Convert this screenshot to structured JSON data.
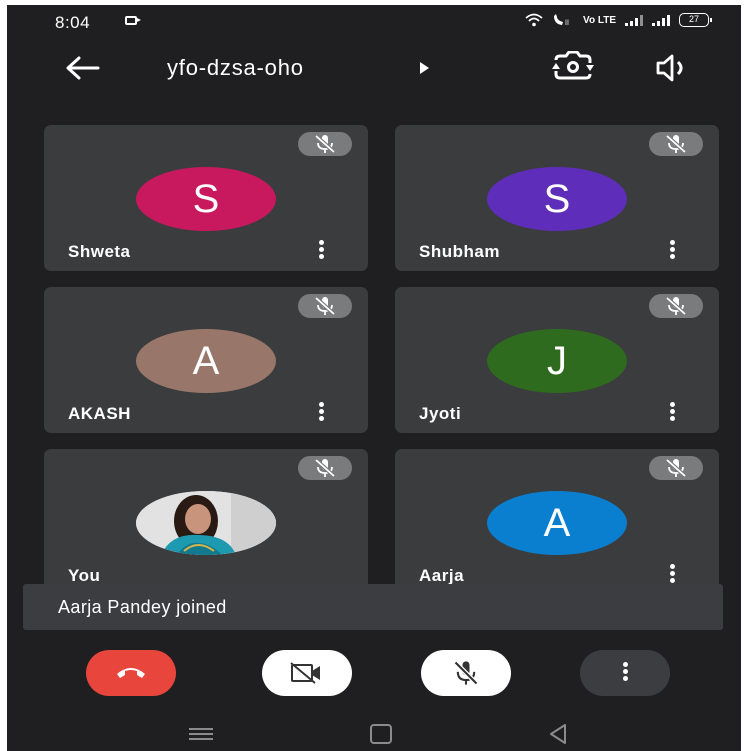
{
  "status_bar": {
    "time": "8:04",
    "network_label": "Vo LTE",
    "battery": "27"
  },
  "header": {
    "meeting_code": "yfo-dzsa-oho"
  },
  "participants": [
    {
      "name": "Shweta",
      "initial": "S",
      "color": "#c8195e",
      "muted": true
    },
    {
      "name": "Shubham",
      "initial": "S",
      "color": "#5e2dba",
      "muted": true
    },
    {
      "name": "AKASH",
      "initial": "A",
      "color": "#99766a",
      "muted": true
    },
    {
      "name": "Jyoti",
      "initial": "J",
      "color": "#2e6b1f",
      "muted": true
    },
    {
      "name": "You",
      "initial": "",
      "color": "#e4e4e4",
      "muted": true
    },
    {
      "name": "Aarja",
      "initial": "A",
      "color": "#0a7fcf",
      "muted": true
    }
  ],
  "toast": {
    "message": "Aarja Pandey joined"
  },
  "controls": {
    "end_call_color": "#e8453c",
    "camera_state": "off",
    "mic_state": "muted"
  },
  "icons": {
    "back": "arrow-left-icon",
    "title_dropdown": "caret-right-icon",
    "switch_camera": "switch-camera-icon",
    "speaker": "speaker-icon",
    "mic_off": "mic-off-icon",
    "more": "more-vertical-icon",
    "end_call": "phone-hangup-icon",
    "camera_off": "video-off-icon"
  }
}
